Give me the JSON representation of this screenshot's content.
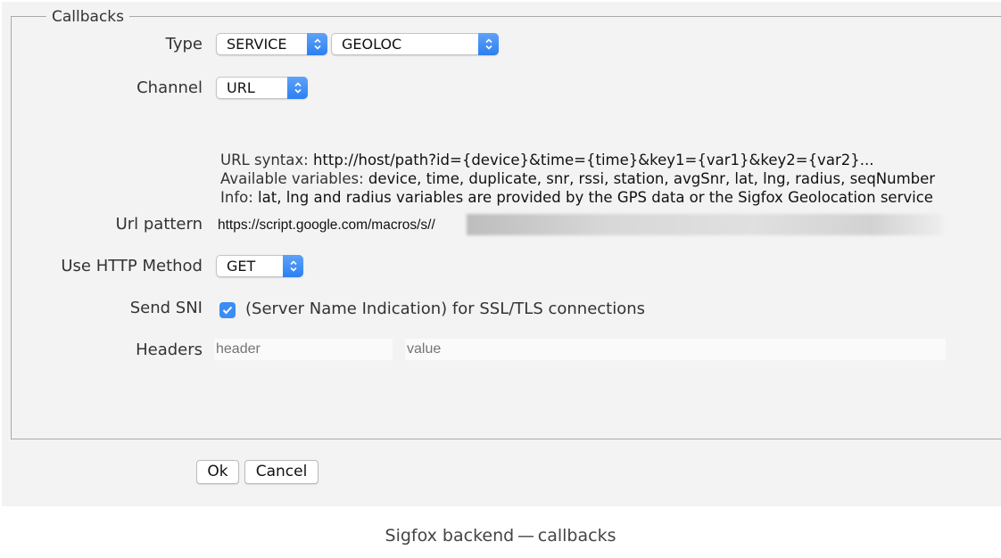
{
  "fieldset": {
    "legend": "Callbacks"
  },
  "form": {
    "type": {
      "label": "Type",
      "value1": "SERVICE",
      "value2": "GEOLOC"
    },
    "channel": {
      "label": "Channel",
      "value": "URL"
    },
    "info": {
      "line1_prefix": "URL syntax: ",
      "line1_value": "http://host/path?id={device}&time={time}&key1={var1}&key2={var2}...",
      "line2_prefix": "Available variables: ",
      "line2_value": "device, time, duplicate, snr, rssi, station, avgSnr, lat, lng, radius, seqNumber",
      "line3_prefix": "Info: ",
      "line3_value": "lat, lng and radius variables are provided by the GPS data or the Sigfox Geolocation service"
    },
    "url_pattern": {
      "label": "Url pattern",
      "value": "https://script.google.com/macros/s//"
    },
    "http_method": {
      "label": "Use HTTP Method",
      "value": "GET"
    },
    "send_sni": {
      "label": "Send SNI",
      "checked": true,
      "checkbox_label": "(Server Name Indication) for SSL/TLS connections"
    },
    "headers": {
      "label": "Headers",
      "key_placeholder": "header",
      "value_placeholder": "value"
    }
  },
  "buttons": {
    "ok": "Ok",
    "cancel": "Cancel"
  },
  "caption": "Sigfox backend — callbacks",
  "colors": {
    "accent": "#3a8df5",
    "background": "#f3f3f3"
  },
  "icons": {
    "select_arrows": "updown-chevron-icon",
    "checkbox": "checkmark-icon"
  }
}
